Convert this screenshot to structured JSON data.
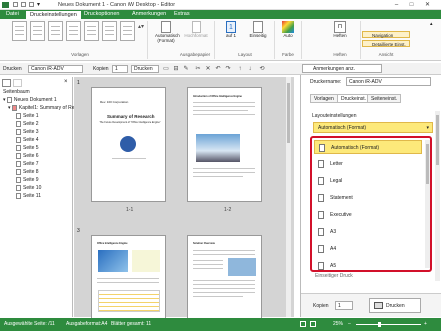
{
  "window": {
    "title": "Neues Dokument 1 - Canon iW Desktop - Editor"
  },
  "ribbon_tabs": [
    "Datei",
    "Druckeinstellungen",
    "Druckoptionen",
    "Anmerkungen",
    "Extras"
  ],
  "ribbon": {
    "group_vorlagen": "Vorlagen",
    "group_ausgabepapier": "Ausgabepapier",
    "group_layout": "Layout",
    "group_farbe": "Farbe",
    "group_heften": "Heften",
    "group_ansicht": "Ansicht",
    "ausgabeformat_label": "Automatisch (Format)",
    "ausrichtung_label": "Hochformat",
    "nup_value": "1",
    "nup_label": "auf 1",
    "duplex_label": "Einseitig",
    "color_label": "Auto",
    "staple_label": "Heften",
    "navigation_label": "Navigation",
    "detail_label": "Detaillierte Einst."
  },
  "toolbar": {
    "printer_label": "Drucken",
    "printer_value": "Canon iR-ADV",
    "copies_label": "Kopien",
    "copies_value": "1",
    "print_button": "Drucken",
    "annotations_button": "Anmerkungen anz."
  },
  "tree": {
    "header": "Seitenbaum",
    "root": "Neues Dokument 1",
    "chapter": "Kapitel1: Summary of Re",
    "pages": [
      "Seite 1",
      "Seite 2",
      "Seite 3",
      "Seite 4",
      "Seite 5",
      "Seite 6",
      "Seite 7",
      "Seite 8",
      "Seite 9",
      "Seite 10",
      "Seite 11"
    ]
  },
  "preview": {
    "group1": "1",
    "group3": "3",
    "page1_label": "1-1",
    "page2_label": "1-2",
    "page1_header": "Rev. 100 Corporation",
    "page1_title": "Summary of Research",
    "page1_subtitle": "The Future Development of \"Office Intelligence Engine\"",
    "page2_title": "Introduction of Office Intelligence Engine",
    "page3_title": "Office Intelligence Engine",
    "page4_title": "Solution Overview"
  },
  "rightpanel": {
    "printer_label": "Druckername:",
    "printer_value": "Canon iR-ADV",
    "tabs": [
      "Vorlagen",
      "Druckeinst.",
      "Seiteneinst."
    ],
    "section": "Layouteinstellungen",
    "format_value": "Automatisch (Format)",
    "dropdown_items": [
      "Automatisch (Format)",
      "Letter",
      "Legal",
      "Statement",
      "Executive",
      "A3",
      "A4",
      "A5"
    ],
    "below_dropdown": "Einseitiger Druck",
    "copies_label": "Kopien",
    "copies_value": "1",
    "print_button": "Drucken"
  },
  "statusbar": {
    "selected_page": "Ausgewählte Seite: /11",
    "format": "Ausgabeformat:A4",
    "total": "Blätter gesamt: 11",
    "zoom": "25%"
  },
  "colors": {
    "accent": "#2e8b3e",
    "highlight": "#d2102a",
    "selected_bg": "#fde97a"
  }
}
